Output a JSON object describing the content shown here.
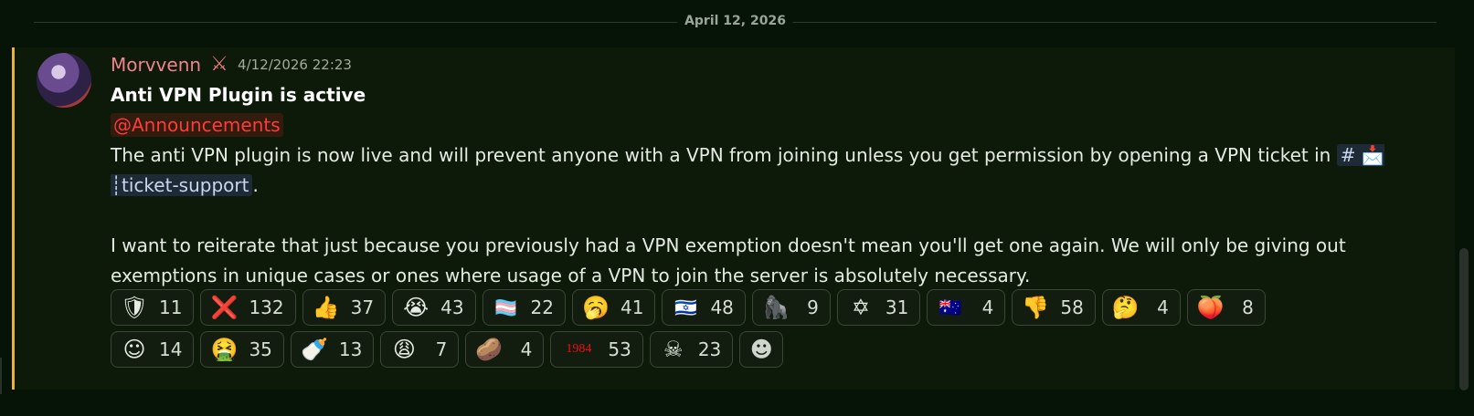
{
  "divider": {
    "date": "April 12, 2026"
  },
  "message": {
    "username": "Morvvenn",
    "timestamp": "4/12/2026 22:23",
    "title": "Anti VPN Plugin is active",
    "role_mention": "@Announcements",
    "body1_before_channel": "The anti VPN plugin is now live and will prevent anyone with a VPN from joining unless you get permission by opening a VPN ticket in",
    "channel_name": "# 📩 ┊ticket-support",
    "body1_after_channel": ".",
    "body2": "I want to reiterate that just because you previously had a VPN exemption doesn't mean you'll get one again. We will only be giving out exemptions in unique cases or ones where usage of a VPN to join the server is absolutely necessary."
  },
  "reactions": [
    {
      "icon": "shield-emblem",
      "glyph": "🛡",
      "count": "11"
    },
    {
      "icon": "cross-mark",
      "glyph": "❌",
      "count": "132"
    },
    {
      "icon": "thumbs-up",
      "glyph": "👍",
      "count": "37"
    },
    {
      "icon": "loudly-crying-face",
      "glyph": "😭",
      "count": "43"
    },
    {
      "icon": "transgender-flag",
      "glyph": "🏳️‍⚧️",
      "count": "22"
    },
    {
      "icon": "yawning-face",
      "glyph": "🥱",
      "count": "41"
    },
    {
      "icon": "israel-flag",
      "glyph": "🇮🇱",
      "count": "48"
    },
    {
      "icon": "gorilla",
      "glyph": "🦍",
      "count": "9"
    },
    {
      "icon": "star-of-david",
      "glyph": "✡",
      "count": "31"
    },
    {
      "icon": "australia-flag",
      "glyph": "🇦🇺",
      "count": "4"
    },
    {
      "icon": "thumbs-down",
      "glyph": "👎",
      "count": "58"
    },
    {
      "icon": "person-thinking",
      "glyph": "🤔",
      "count": "4"
    },
    {
      "icon": "peach",
      "glyph": "🍑",
      "count": "8"
    },
    {
      "icon": "meme-face",
      "glyph": "☺",
      "count": "14"
    },
    {
      "icon": "vomiting-face",
      "glyph": "🤮",
      "count": "35"
    },
    {
      "icon": "bottle-person",
      "glyph": "🍼",
      "count": "13"
    },
    {
      "icon": "weary-face",
      "glyph": "😩",
      "count": "7"
    },
    {
      "icon": "potato",
      "glyph": "🥔",
      "count": "4"
    },
    {
      "icon": "1984-text",
      "glyph": "1984",
      "count": "53"
    },
    {
      "icon": "pirate-flag",
      "glyph": "☠",
      "count": "23"
    }
  ],
  "colors": {
    "username": "#f0838f",
    "role_mention": "#ff3b3b",
    "highlight_bar": "#f0b232",
    "background": "#061307"
  }
}
